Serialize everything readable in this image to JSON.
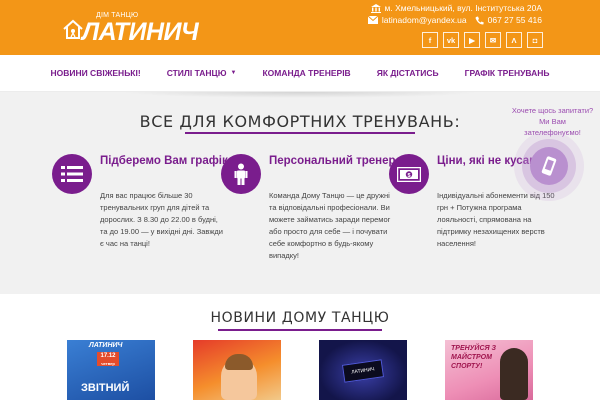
{
  "header": {
    "logo_sub": "ДІМ ТАНЦЮ",
    "logo_main": "ЛАТИНИЧ",
    "address": "м. Хмельницький, вул. Інститутська 20А",
    "email": "latinadom@yandex.ua",
    "phone": "067 27 55 416",
    "socials": [
      {
        "label": "f",
        "icon": "facebook-icon"
      },
      {
        "label": "vk",
        "icon": "vk-icon"
      },
      {
        "label": "▶",
        "icon": "youtube-icon"
      },
      {
        "label": "✉",
        "icon": "mail-icon"
      },
      {
        "label": "Λ",
        "icon": "lambda-icon"
      },
      {
        "label": "◘",
        "icon": "instagram-icon"
      }
    ]
  },
  "nav": {
    "items": [
      {
        "label": "НОВИНИ СВІЖЕНЬКІ!"
      },
      {
        "label": "СТИЛІ ТАНЦЮ",
        "caret": "▼"
      },
      {
        "label": "КОМАНДА ТРЕНЕРІВ"
      },
      {
        "label": "ЯК ДІСТАТИСЬ"
      },
      {
        "label": "ГРАФІК ТРЕНУВАНЬ"
      }
    ]
  },
  "main": {
    "title": "ВСЕ ДЛЯ КОМФОРТНИХ ТРЕНУВАНЬ:",
    "features": [
      {
        "icon": "list-icon",
        "title": "Підберемо Вам графік",
        "text": "Для вас працює більше 30 тренувальних груп для дітей та дорослих. З 8.30 до 22.00 в будні, та до 19.00 — у вихідні дні. Завжди є час на танці!"
      },
      {
        "icon": "person-icon",
        "title": "Персональний тренер",
        "text": "Команда Дому Танцю — це дружні та відповідальні професіонали. Ви можете займатись заради перемог або просто для себе — і почувати себе комфортно в будь-якому випадку!"
      },
      {
        "icon": "money-icon",
        "title": "Ціни, які не кусаються",
        "text": "Індивідуальні абонементи від 150 грн + Потужна програма лояльності, спрямована на підтримку незахищених верств населення!"
      }
    ],
    "callback": {
      "line1": "Хочете щось запитати?",
      "line2": "Ми Вам",
      "line3": "зателефонуємо!"
    }
  },
  "news": {
    "title": "НОВИНИ ДОМУ ТАНЦЮ",
    "items": [
      {
        "wm": "ЛАТИНИЧ",
        "badge": "17.12",
        "badge_sub": "четвер",
        "big": "ЗВІТНИЙ"
      },
      {},
      {
        "card": "ЛАТИНИЧ"
      },
      {
        "promo": "ТРЕНУЙСЯ З МАЙСТРОМ СПОРТУ!"
      }
    ]
  },
  "colors": {
    "header": "#f39617",
    "accent": "#7a1d8d",
    "callback": "#9b4cb0"
  }
}
